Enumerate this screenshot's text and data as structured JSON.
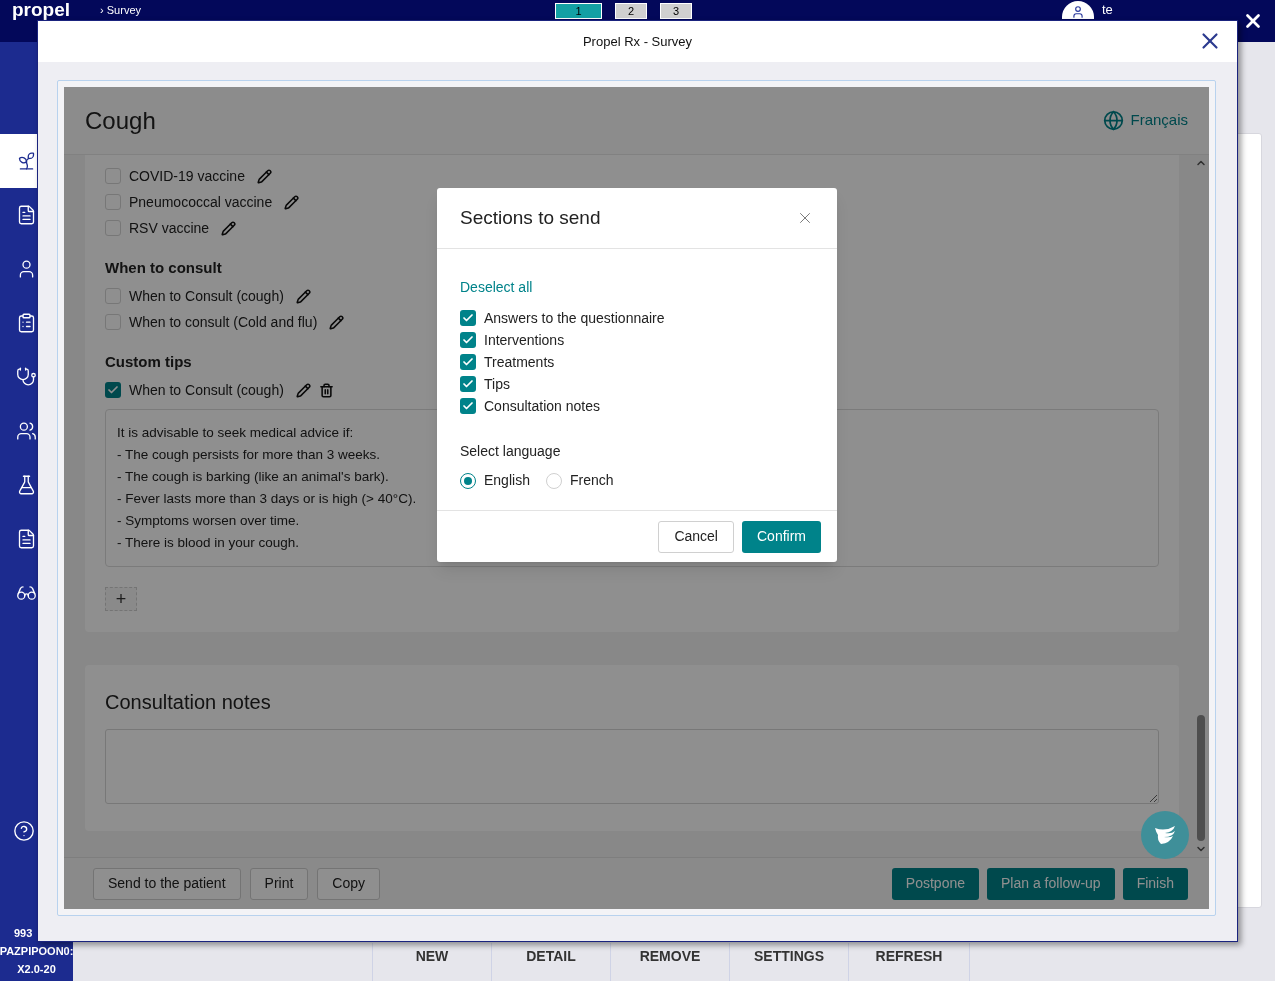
{
  "app": {
    "logo": "propel",
    "breadcrumb": "› Survey",
    "tabs": [
      {
        "label": "1",
        "selected": true
      },
      {
        "label": "2",
        "selected": false
      },
      {
        "label": "3",
        "selected": false
      }
    ],
    "user": "te",
    "status_lines": [
      "993",
      "PAZPIPOON0:",
      "X2.0-20"
    ],
    "toolbar": [
      "NEW",
      "DETAIL",
      "REMOVE",
      "SETTINGS",
      "REFRESH"
    ]
  },
  "window": {
    "title": "Propel Rx - Survey"
  },
  "survey": {
    "title": "Cough",
    "language_link": "Français",
    "groups": [
      {
        "items": [
          {
            "label": "COVID-19 vaccine",
            "checked": false,
            "deletable": false
          },
          {
            "label": "Pneumococcal vaccine",
            "checked": false,
            "deletable": false
          },
          {
            "label": "RSV vaccine",
            "checked": false,
            "deletable": false
          }
        ]
      },
      {
        "heading": "When to consult",
        "items": [
          {
            "label": "When to Consult (cough)",
            "checked": false,
            "deletable": false
          },
          {
            "label": "When to consult (Cold and flu)",
            "checked": false,
            "deletable": false
          }
        ]
      },
      {
        "heading": "Custom tips",
        "items": [
          {
            "label": "When to Consult (cough)",
            "checked": true,
            "deletable": true
          }
        ]
      }
    ],
    "tip_text": [
      "It is advisable to seek medical advice if:",
      "- The cough persists for more than 3 weeks.",
      "- The cough is barking (like an animal's bark).",
      "- Fever lasts more than 3 days or is high (> 40°C).",
      "- Symptoms worsen over time.",
      "- There is blood in your cough."
    ],
    "add_button": "+",
    "notes_heading": "Consultation notes",
    "footer_left": [
      "Send to the patient",
      "Print",
      "Copy"
    ],
    "footer_right": [
      "Postpone",
      "Plan a follow-up",
      "Finish"
    ]
  },
  "dialog": {
    "title": "Sections to send",
    "deselect_link": "Deselect all",
    "sections": [
      {
        "label": "Answers to the questionnaire",
        "checked": true
      },
      {
        "label": "Interventions",
        "checked": true
      },
      {
        "label": "Treatments",
        "checked": true
      },
      {
        "label": "Tips",
        "checked": true
      },
      {
        "label": "Consultation notes",
        "checked": true
      }
    ],
    "language_label": "Select language",
    "languages": [
      {
        "label": "English",
        "selected": true
      },
      {
        "label": "French",
        "selected": false
      }
    ],
    "cancel": "Cancel",
    "confirm": "Confirm"
  }
}
